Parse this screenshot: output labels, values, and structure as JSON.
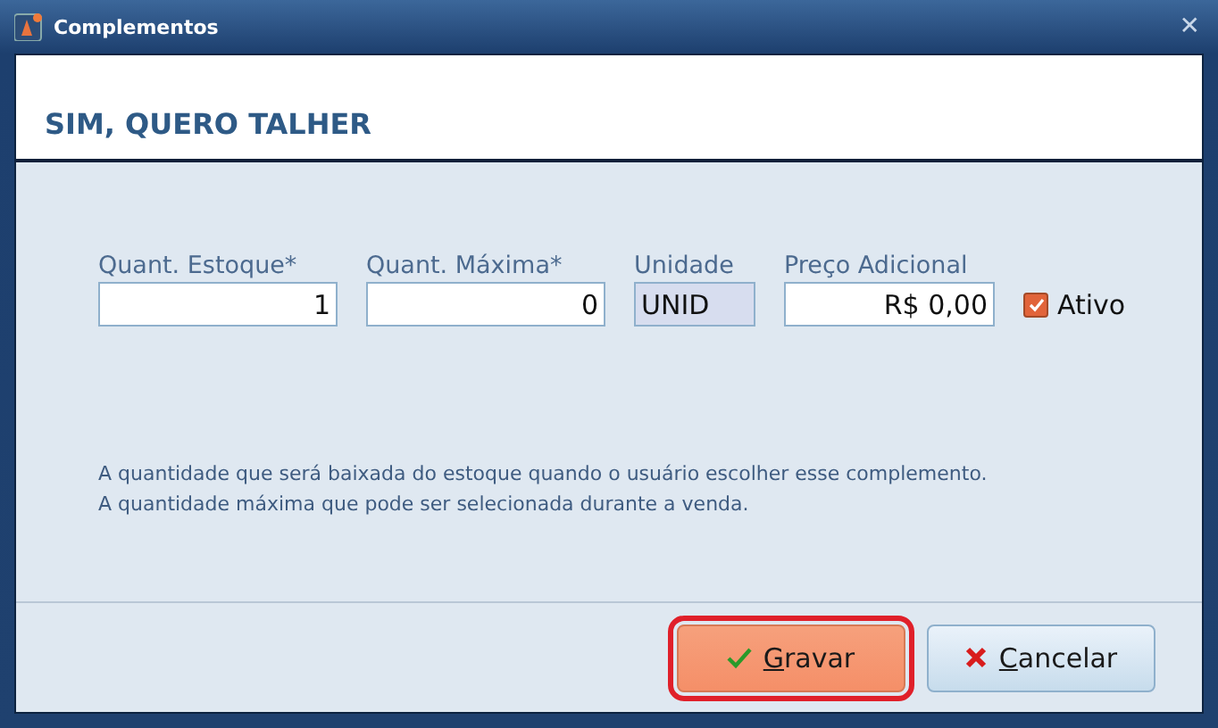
{
  "window": {
    "title": "Complementos",
    "close": "✕"
  },
  "header": {
    "title": "SIM, QUERO TALHER"
  },
  "fields": [
    {
      "label": "Quant. Estoque*",
      "value": "1",
      "kind": "number",
      "disabled": false
    },
    {
      "label": "Quant. Máxima*",
      "value": "0",
      "kind": "number",
      "disabled": false
    },
    {
      "label": "Unidade",
      "value": "UNID",
      "kind": "text",
      "disabled": true
    },
    {
      "label": "Preço Adicional",
      "value": "R$ 0,00",
      "kind": "number",
      "disabled": false
    }
  ],
  "active": {
    "label": "Ativo",
    "checked": true
  },
  "notes": [
    "A quantidade que será baixada do estoque quando o usuário escolher esse complemento.",
    "A quantidade máxima que pode ser selecionada durante a venda."
  ],
  "buttons": [
    {
      "label": "Gravar",
      "kind": "save",
      "focused": true
    },
    {
      "label": "Cancelar",
      "kind": "cancel",
      "focused": false
    }
  ]
}
